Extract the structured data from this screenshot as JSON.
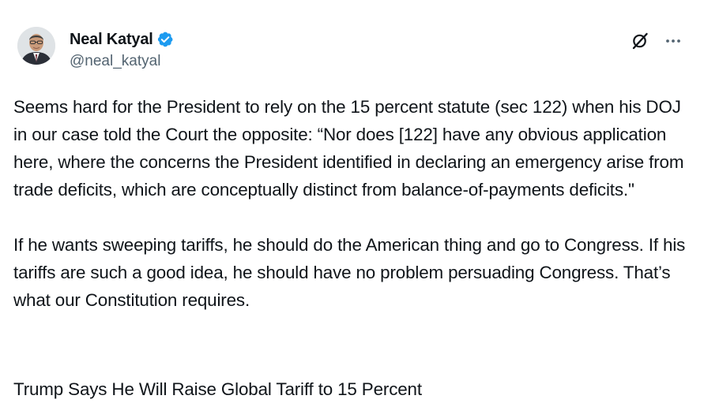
{
  "author": {
    "display_name": "Neal Katyal",
    "handle": "@neal_katyal",
    "verified": true,
    "verified_color": "#1d9bf0"
  },
  "header_actions": {
    "grok_icon": "grok-icon",
    "more_icon": "more-horizontal-icon"
  },
  "tweet": {
    "paragraphs": [
      "Seems hard for the President to rely on the 15 percent statute (sec 122) when his DOJ in our case told the Court the opposite: “Nor does [122] have any obvious application here, where the concerns the President identified in declaring an emergency arise from trade deficits, which are conceptually distinct from balance-of-payments deficits.\"",
      "If he wants sweeping tariffs, he should do the American thing and go to Congress. If his tariffs are such a good idea, he should have no problem persuading Congress. That’s what our Constitution requires."
    ],
    "linked_headline": "Trump Says He Will Raise Global Tariff to 15 Percent"
  },
  "colors": {
    "text_primary": "#0f1419",
    "text_secondary": "#536471",
    "background": "#ffffff"
  }
}
